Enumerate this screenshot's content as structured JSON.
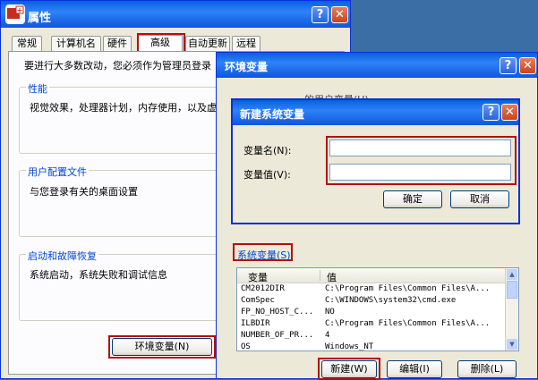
{
  "props_window": {
    "title": "属性",
    "tabs": [
      "常规",
      "计算机名",
      "硬件",
      "高级",
      "自动更新",
      "远程"
    ],
    "admin_note": "要进行大多数改动，您必须作为管理员登录",
    "perf_legend": "性能",
    "perf_desc": "视觉效果，处理器计划，内存使用，以及虚",
    "profile_legend": "用户配置文件",
    "profile_desc": "与您登录有关的桌面设置",
    "startup_legend": "启动和故障恢复",
    "startup_desc": "系统启动，系统失败和调试信息",
    "env_button": "环境变量(N)"
  },
  "env_window": {
    "title": "环境变量",
    "user_vars_partial": "的用户变量(U)",
    "system_vars_label": "系统变量(S)",
    "columns": [
      "变量",
      "值"
    ],
    "rows": [
      {
        "name": "CM2012DIR",
        "value": "C:\\Program Files\\Common Files\\A..."
      },
      {
        "name": "ComSpec",
        "value": "C:\\WINDOWS\\system32\\cmd.exe"
      },
      {
        "name": "FP_NO_HOST_C...",
        "value": "NO"
      },
      {
        "name": "ILBDIR",
        "value": "C:\\Program Files\\Common Files\\A..."
      },
      {
        "name": "NUMBER_OF_PR...",
        "value": "4"
      },
      {
        "name": "OS",
        "value": "Windows_NT"
      }
    ],
    "new_button": "新建(W)",
    "edit_button": "编辑(I)",
    "delete_button": "删除(L)"
  },
  "new_var_dialog": {
    "title": "新建系统变量",
    "name_label": "变量名(N):",
    "value_label": "变量值(V):",
    "name_value": "",
    "value_value": "",
    "ok_button": "确定",
    "cancel_button": "取消"
  },
  "colors": {
    "title_blue": "#0a5fe0",
    "highlight_red": "#b40f0f",
    "dialog_bg": "#ece9d8"
  }
}
